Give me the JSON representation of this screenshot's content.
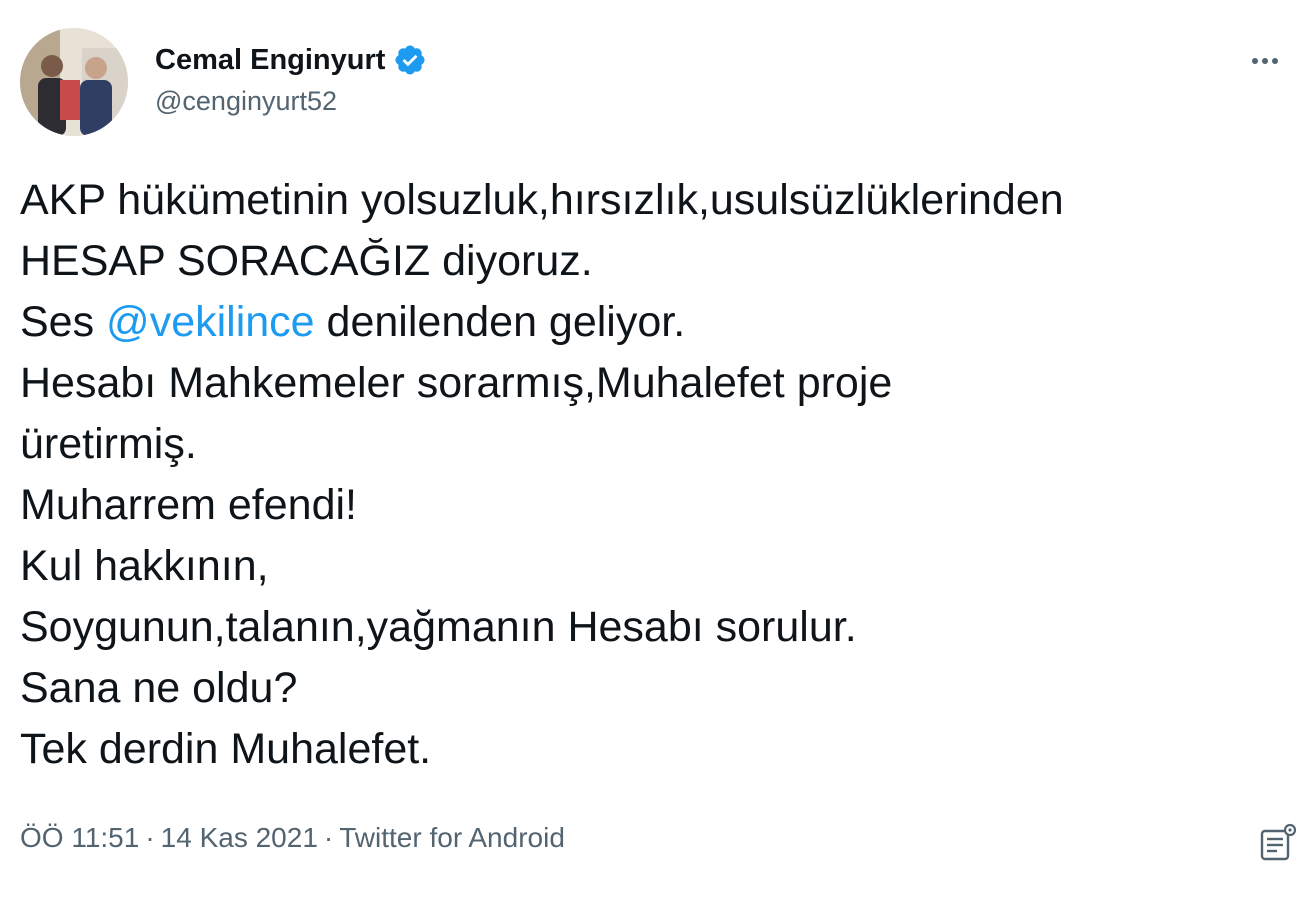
{
  "author": {
    "display_name": "Cemal Enginyurt",
    "handle": "@cenginyurt52",
    "avatar_icon": "profile-photo",
    "verified_icon": "verified-badge-icon"
  },
  "tweet": {
    "lines": [
      {
        "text": "AKP hükümetinin yolsuzluk,hırsızlık,usulsüzlüklerinden"
      },
      {
        "text": "HESAP SORACAĞIZ diyoruz."
      },
      {
        "prefix": "Ses ",
        "mention": "@vekilince",
        "suffix": " denilenden geliyor."
      },
      {
        "text": "Hesabı Mahkemeler sorarmış,Muhalefet proje"
      },
      {
        "text": "üretirmiş."
      },
      {
        "text": "Muharrem efendi!"
      },
      {
        "text": "Kul hakkının,"
      },
      {
        "text": "Soygunun,talanın,yağmanın Hesabı sorulur."
      },
      {
        "text": "Sana ne oldu?"
      },
      {
        "text": "Tek derdin Muhalefet."
      }
    ]
  },
  "meta": {
    "time": "ÖÖ 11:51",
    "separator": "·",
    "date": "14 Kas 2021",
    "source": "Twitter for Android"
  },
  "icons": {
    "more": "more-dots-icon",
    "analytics": "analytics-icon"
  },
  "colors": {
    "text": "#0f1419",
    "secondary": "#536471",
    "link": "#1d9bf0",
    "verified": "#1d9bf0"
  }
}
